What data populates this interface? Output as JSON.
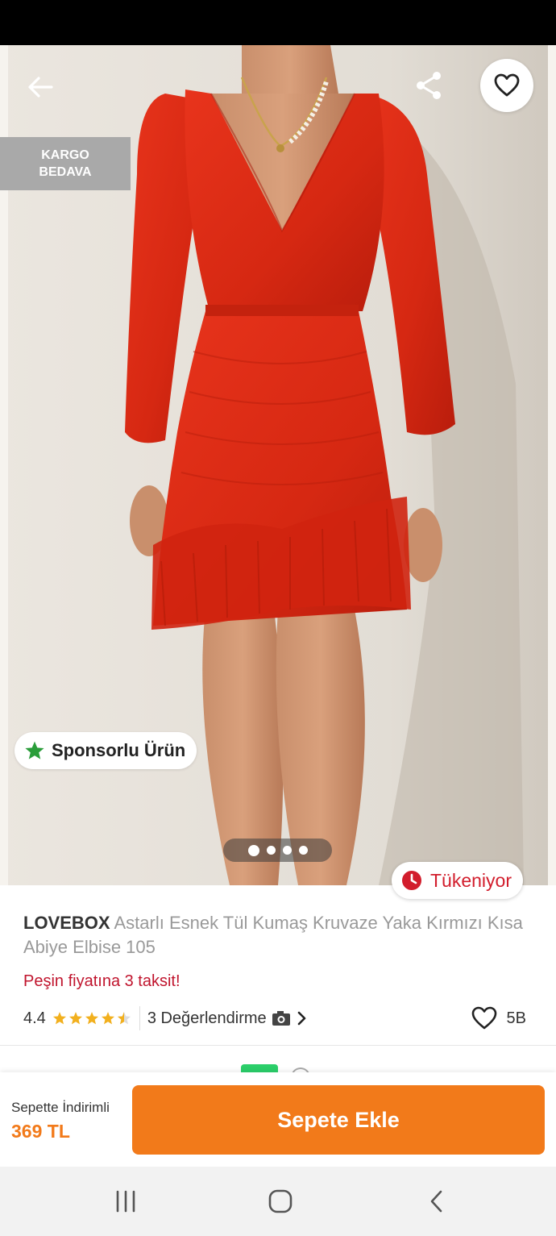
{
  "hero": {
    "badge_line1": "KARGO",
    "badge_line2": "BEDAVA",
    "sponsor_label": "Sponsorlu Ürün",
    "stock_label": "Tükeniyor",
    "image_count": 4,
    "active_image": 1
  },
  "product": {
    "brand": "LOVEBOX",
    "name": "Astarlı Esnek Tül Kumaş Kruvaze Yaka Kırmızı Kısa Abiye Elbise 105",
    "installment_text": "Peşin fiyatına 3 taksit!",
    "rating": "4.4",
    "rating_value": 4.4,
    "reviews_text": "3 Değerlendirme",
    "favorites_count": "5B"
  },
  "bottom_bar": {
    "price_label": "Sepette İndirimli",
    "price": "369 TL",
    "add_to_cart_label": "Sepete Ekle"
  },
  "colors": {
    "brand_orange": "#f27a1a",
    "alert_red": "#d21d2c",
    "installment_red": "#c0142d",
    "star_yellow": "#f2b01e",
    "sponsor_green": "#2a9d3a",
    "dress_red": "#dd2a16"
  },
  "icons": {
    "back": "arrow-left-icon",
    "share": "share-icon",
    "favorite": "heart-icon",
    "sponsor": "star-icon",
    "stock": "clock-icon",
    "camera": "camera-icon",
    "chevron": "chevron-right-icon",
    "nav_recents": "recents-icon",
    "nav_home": "home-icon",
    "nav_back": "nav-back-icon"
  }
}
